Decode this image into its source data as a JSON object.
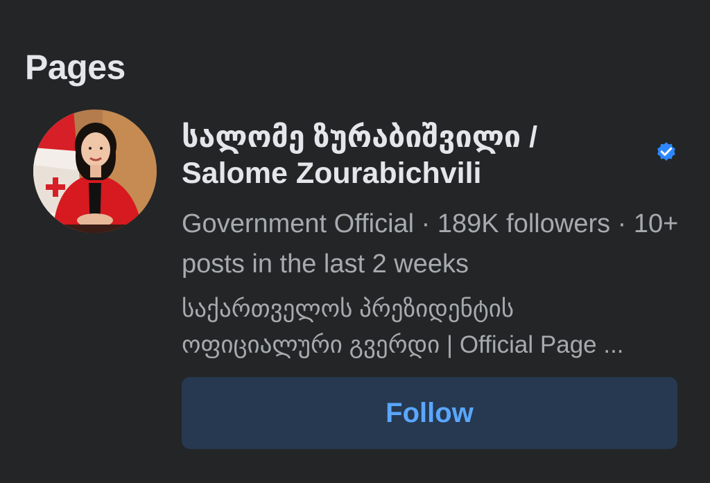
{
  "section": {
    "title": "Pages"
  },
  "page_result": {
    "name": "სალომე ზურაბიშვილი / Salome Zourabichvili",
    "verified_icon": "verified-badge-icon",
    "meta": "Government Official · 189K followers · 10+ posts in the last 2 weeks",
    "description": "საქართველოს პრეზიდენტის ოფიციალური გვერდი | Official Page ...",
    "follow_label": "Follow"
  },
  "colors": {
    "background": "#242526",
    "primary_text": "#e4e6eb",
    "secondary_text": "#a7aaaf",
    "verified_blue": "#2d88ff",
    "button_bg": "#263951",
    "button_text": "#5aa7ff"
  }
}
